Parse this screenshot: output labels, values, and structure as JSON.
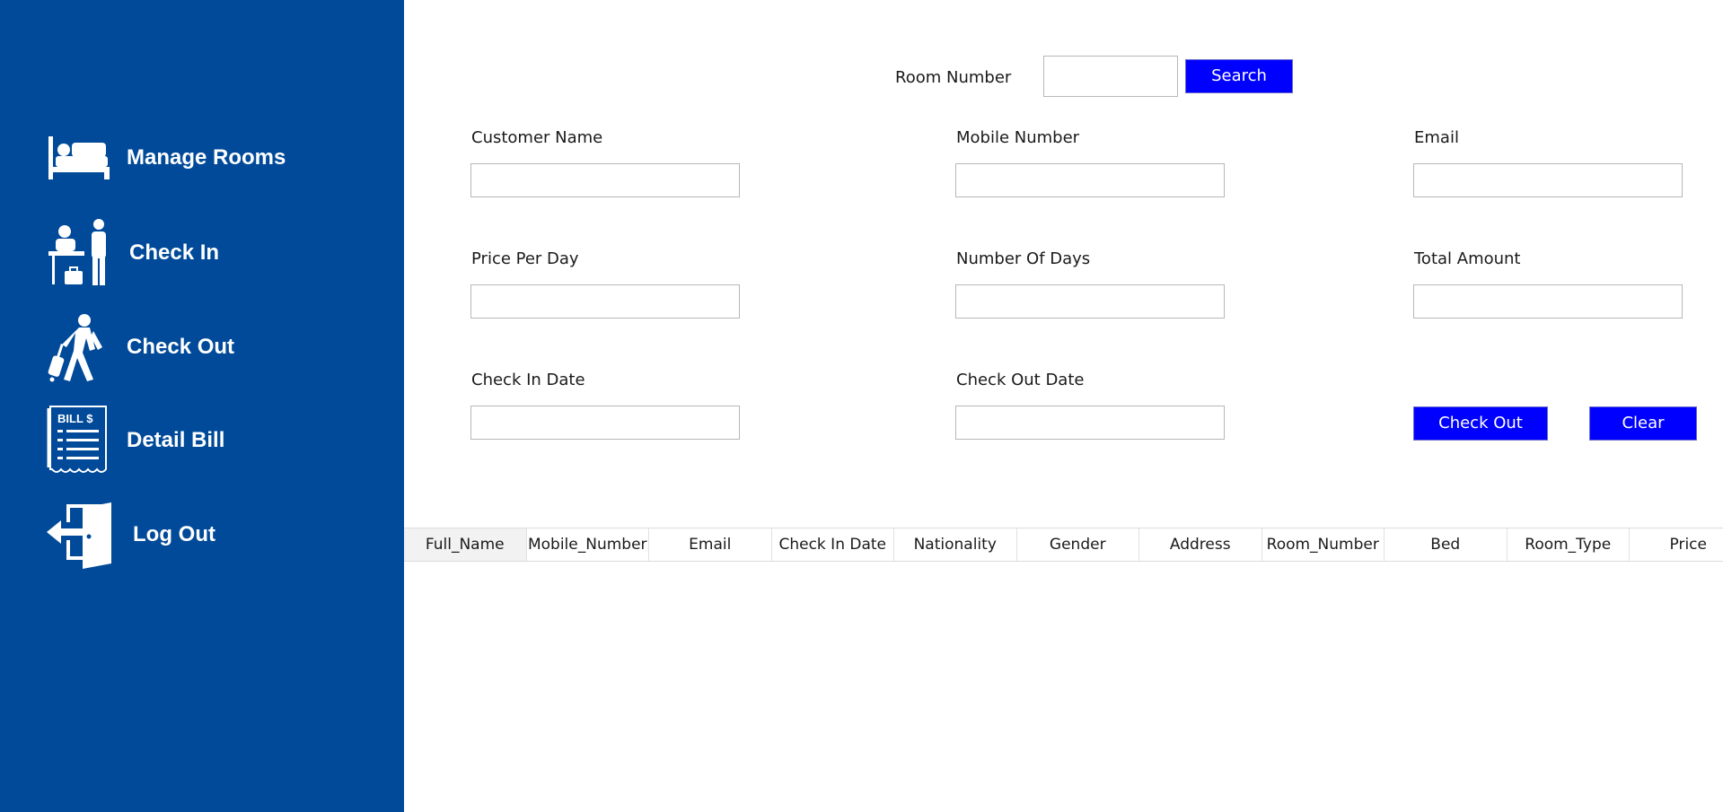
{
  "sidebar": {
    "items": [
      {
        "label": "Manage Rooms",
        "icon": "bed-icon"
      },
      {
        "label": "Check In",
        "icon": "reception-icon"
      },
      {
        "label": "Check Out",
        "icon": "walking-luggage-icon"
      },
      {
        "label": "Detail Bill",
        "icon": "bill-icon"
      },
      {
        "label": "Log Out",
        "icon": "exit-door-icon"
      }
    ],
    "bill_icon_text": "BILL $"
  },
  "search": {
    "label": "Room Number",
    "value": "",
    "button": "Search"
  },
  "form": {
    "customer_name": {
      "label": "Customer Name",
      "value": ""
    },
    "mobile_number": {
      "label": "Mobile Number",
      "value": ""
    },
    "email": {
      "label": "Email",
      "value": ""
    },
    "price_per_day": {
      "label": "Price Per Day",
      "value": ""
    },
    "number_of_days": {
      "label": "Number Of Days",
      "value": ""
    },
    "total_amount": {
      "label": "Total Amount",
      "value": ""
    },
    "check_in_date": {
      "label": "Check In Date",
      "value": ""
    },
    "check_out_date": {
      "label": "Check Out Date",
      "value": ""
    }
  },
  "actions": {
    "check_out": "Check Out",
    "clear": "Clear"
  },
  "table": {
    "columns": [
      "Full_Name",
      "Mobile_Number",
      "Email",
      "Check In Date",
      "Nationality",
      "Gender",
      "Address",
      "Room_Number",
      "Bed",
      "Room_Type",
      "Price"
    ],
    "rows": []
  },
  "colors": {
    "sidebar": "#004a99",
    "button": "#0000ff",
    "text_on_dark": "#ffffff"
  }
}
